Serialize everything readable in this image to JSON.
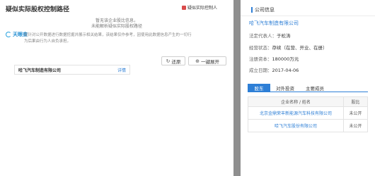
{
  "modal": {
    "title": "疑似实际股权控制路径",
    "flag_label": "疑似实际控制人",
    "empty_line1": "暂无该企业股比信息，",
    "empty_line2": "未能解析疑似实际股权路径",
    "logo_text": "天眼查",
    "disclaimer_line1": "仅针对公开数据进行数据挖掘并展示相关结果，该结果仅作参考，因使用此数据信息产生的一切行",
    "disclaimer_line2": "为后果由行为人自负承担。",
    "restore_label": "还原",
    "expand_label": "一键展开",
    "node": {
      "name": "哈飞汽车制造有限公司",
      "link": "详情"
    }
  },
  "drawer": {
    "title": "公司信息",
    "company_name": "哈飞汽车制造有限公司",
    "rows": [
      {
        "label": "法定代表人：",
        "value": "于松涛"
      },
      {
        "label": "经营状态：",
        "value": "存续（在营、开业、在册）"
      },
      {
        "label": "注册资本：",
        "value": "180000万元"
      },
      {
        "label": "成立日期：",
        "value": "2017-04-06"
      }
    ],
    "tabs": [
      "股东",
      "对外投资",
      "主要成员"
    ],
    "table": {
      "headers": [
        "企业名称 / 姓名",
        "股比"
      ],
      "rows": [
        {
          "name": "北京金鼎荣丰新能源汽车科技有限公司",
          "ratio": "未公开"
        },
        {
          "name": "哈飞汽车股份有限公司",
          "ratio": "未公开"
        }
      ]
    }
  }
}
